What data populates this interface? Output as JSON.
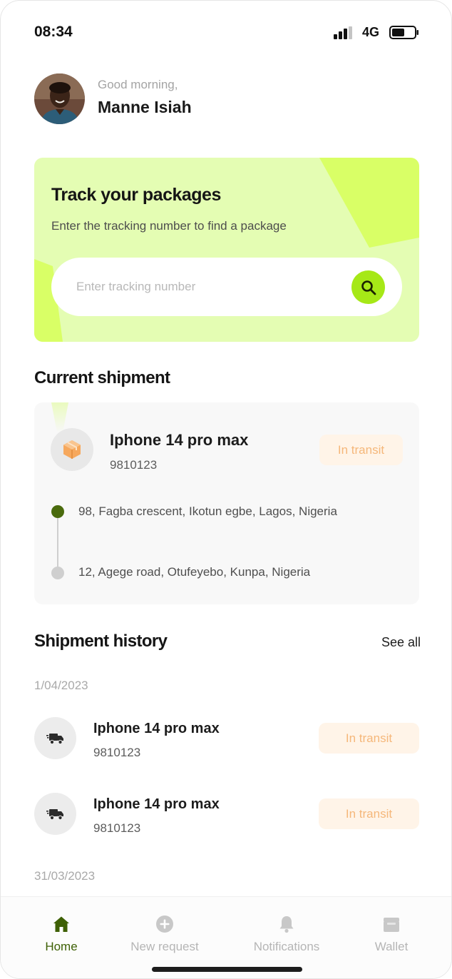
{
  "status_bar": {
    "time": "08:34",
    "network": "4G"
  },
  "greeting": {
    "text": "Good morning,",
    "name": "Manne Isiah"
  },
  "track": {
    "title": "Track your packages",
    "subtitle": "Enter the tracking number to find a package",
    "placeholder": "Enter tracking number",
    "icon": "search-icon"
  },
  "current_shipment": {
    "title": "Current shipment",
    "item_name": "Iphone 14 pro max",
    "tracking_id": "9810123",
    "status": "In transit",
    "from": "98, Fagba crescent, Ikotun egbe, Lagos, Nigeria",
    "to": "12, Agege road, Otufeyebo, Kunpa, Nigeria",
    "icon": "package-icon"
  },
  "history": {
    "title": "Shipment history",
    "see_all": "See all",
    "groups": [
      {
        "date": "1/04/2023",
        "items": [
          {
            "name": "Iphone 14 pro max",
            "id": "9810123",
            "status": "In transit"
          },
          {
            "name": "Iphone 14 pro max",
            "id": "9810123",
            "status": "In transit"
          }
        ]
      },
      {
        "date": "31/03/2023",
        "items": []
      }
    ]
  },
  "nav": {
    "items": [
      {
        "label": "Home",
        "icon": "home-icon",
        "active": true
      },
      {
        "label": "New request",
        "icon": "plus-circle-icon",
        "active": false
      },
      {
        "label": "Notifications",
        "icon": "bell-icon",
        "active": false
      },
      {
        "label": "Wallet",
        "icon": "wallet-icon",
        "active": false
      }
    ]
  },
  "colors": {
    "accent": "#a6e817",
    "card_bg": "#e4fdb3",
    "nav_active": "#3e6005",
    "badge_text": "#f5b77a",
    "badge_bg": "#fff4e8"
  }
}
